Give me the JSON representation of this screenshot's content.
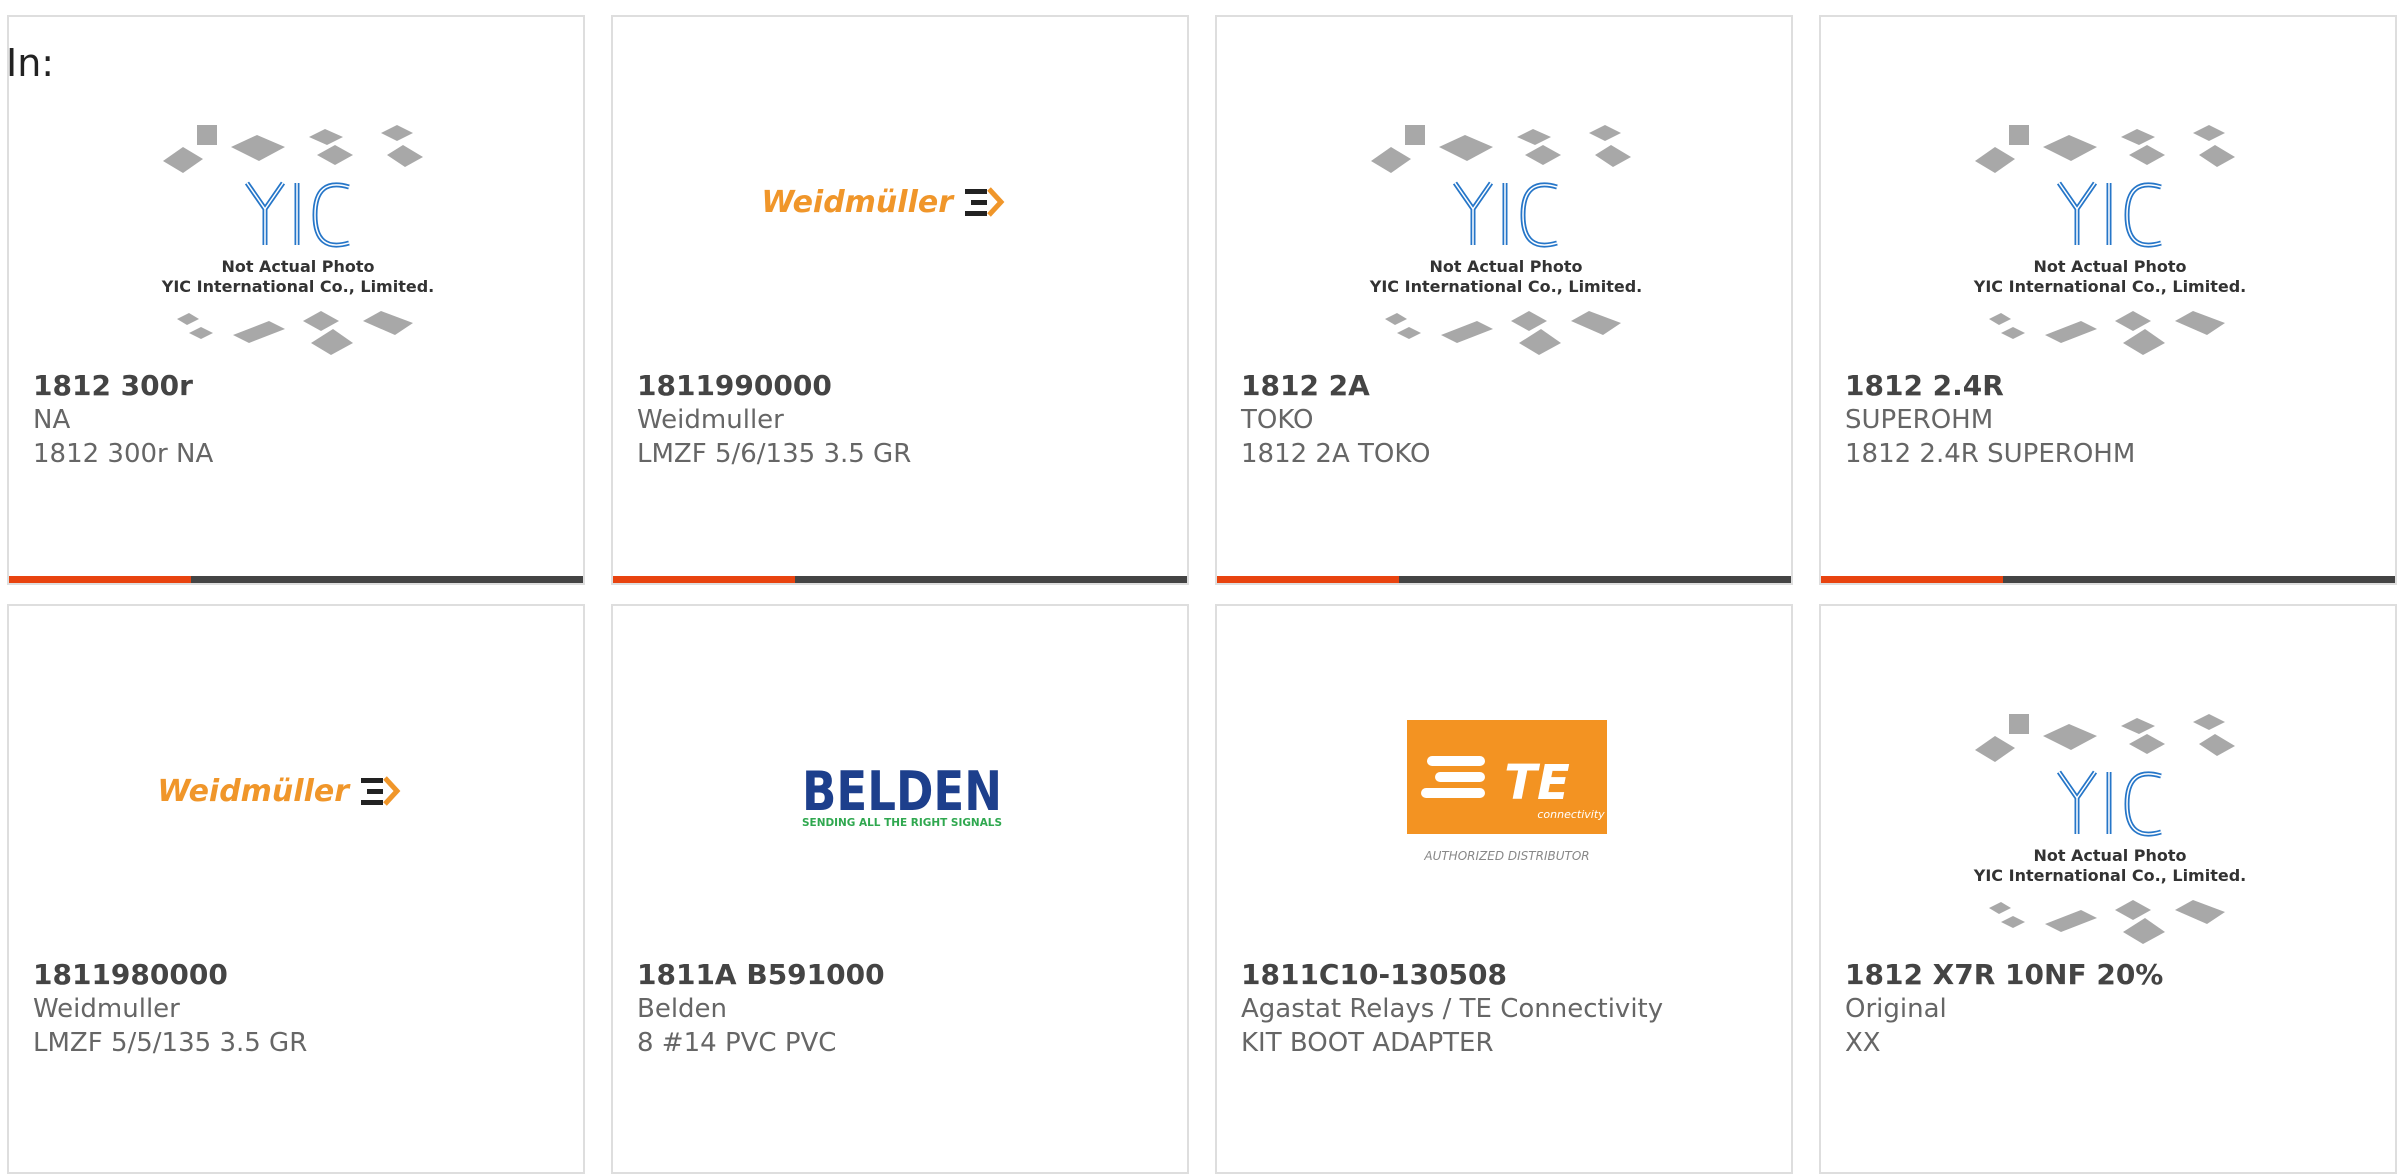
{
  "header": {
    "label": "In:"
  },
  "colors": {
    "accent": "#e8430f",
    "bar": "#444444",
    "weidmuller": "#f0962a",
    "belden": "#1d3f8c",
    "belden_tag": "#2fa84f",
    "te": "#f39322"
  },
  "placeholder": {
    "text1": "Not Actual Photo",
    "text2": "YIC International Co., Limited.",
    "logo": "YIC"
  },
  "logos": {
    "weidmuller": "Weidmüller",
    "belden": "BELDEN",
    "belden_tag": "SENDING ALL THE RIGHT SIGNALS",
    "te_main": "TE",
    "te_sub": "connectivity",
    "te_tag": "AUTHORIZED DISTRIBUTOR"
  },
  "products": [
    {
      "part": "1812 300r",
      "mfr": "NA",
      "desc": "1812 300r NA",
      "image": "yic-placeholder-icon"
    },
    {
      "part": "1811990000",
      "mfr": "Weidmuller",
      "desc": "LMZF 5/6/135 3.5 GR",
      "image": "weidmuller-logo-icon"
    },
    {
      "part": "1812 2A",
      "mfr": "TOKO",
      "desc": "1812 2A TOKO",
      "image": "yic-placeholder-icon"
    },
    {
      "part": "1812 2.4R",
      "mfr": "SUPEROHM",
      "desc": "1812 2.4R SUPEROHM",
      "image": "yic-placeholder-icon"
    },
    {
      "part": "1811980000",
      "mfr": "Weidmuller",
      "desc": "LMZF 5/5/135 3.5 GR",
      "image": "weidmuller-logo-icon"
    },
    {
      "part": "1811A B591000",
      "mfr": "Belden",
      "desc": "8 #14 PVC PVC",
      "image": "belden-logo-icon"
    },
    {
      "part": "1811C10-130508",
      "mfr": "Agastat Relays / TE Connectivity",
      "desc": "KIT BOOT ADAPTER",
      "image": "te-logo-icon"
    },
    {
      "part": "1812 X7R 10NF 20%",
      "mfr": "Original",
      "desc": "XX",
      "image": "yic-placeholder-icon"
    }
  ]
}
